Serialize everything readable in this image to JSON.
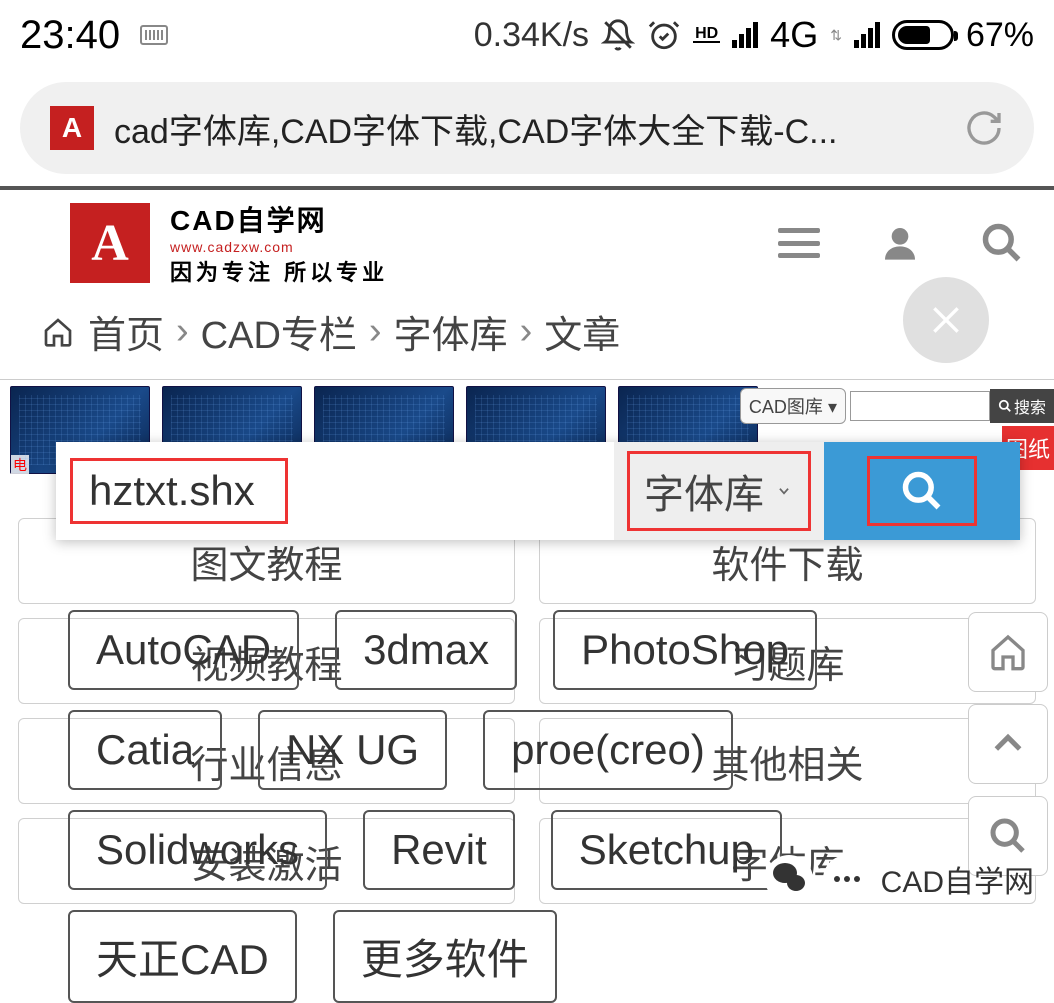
{
  "status": {
    "time": "23:40",
    "speed": "0.34K/s",
    "network": "4G",
    "hd": "HD",
    "battery_pct": "67%"
  },
  "url_bar": {
    "favicon_letter": "A",
    "title": "cad字体库,CAD字体下载,CAD字体大全下载-C..."
  },
  "site": {
    "logo_letter": "A",
    "name": "CAD自学网",
    "domain": "www.cadzxw.com",
    "slogan": "因为专注 所以专业"
  },
  "breadcrumb": {
    "home": "首页",
    "items": [
      "CAD专栏",
      "字体库",
      "文章"
    ]
  },
  "thumb_label": "电",
  "cad_select": "CAD图库",
  "small_search_btn": "搜索",
  "red_tag": "图纸",
  "cards": [
    "图文教程",
    "软件下载",
    "视频教程",
    "习题库",
    "行业信息",
    "其他相关",
    "安装激活",
    "字体库"
  ],
  "search_overlay": {
    "input_value": "hztxt.shx",
    "select_label": "字体库"
  },
  "tags": [
    "AutoCAD",
    "3dmax",
    "PhotoShop",
    "Catia",
    "NX UG",
    "proe(creo)",
    "Solidworks",
    "Revit",
    "Sketchup",
    "天正CAD",
    "更多软件"
  ],
  "wechat_label": "CAD自学网"
}
